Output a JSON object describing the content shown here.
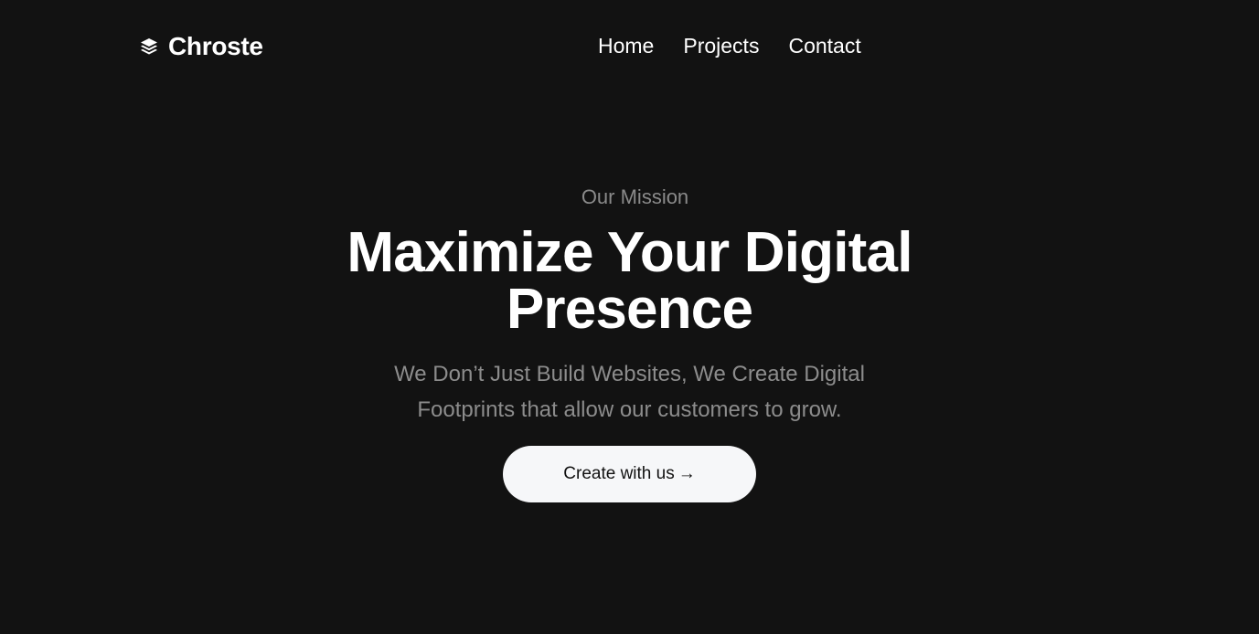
{
  "brand": {
    "name": "Chroste",
    "icon": "layers-icon"
  },
  "nav": {
    "items": [
      {
        "label": "Home"
      },
      {
        "label": "Projects"
      },
      {
        "label": "Contact"
      }
    ]
  },
  "hero": {
    "eyebrow": "Our Mission",
    "headline_line1": "Maximize Your Digital",
    "headline_line2": "Presence",
    "subtitle_line1": "We Don’t Just Build Websites, We Create Digital",
    "subtitle_line2": "Footprints that allow our customers to grow.",
    "cta_label": "Create with us",
    "cta_arrow": "→"
  },
  "colors": {
    "background": "#121212",
    "text_primary": "#ffffff",
    "text_muted": "#8c8c8c",
    "button_bg": "#f6f7f9",
    "button_text": "#111111"
  }
}
